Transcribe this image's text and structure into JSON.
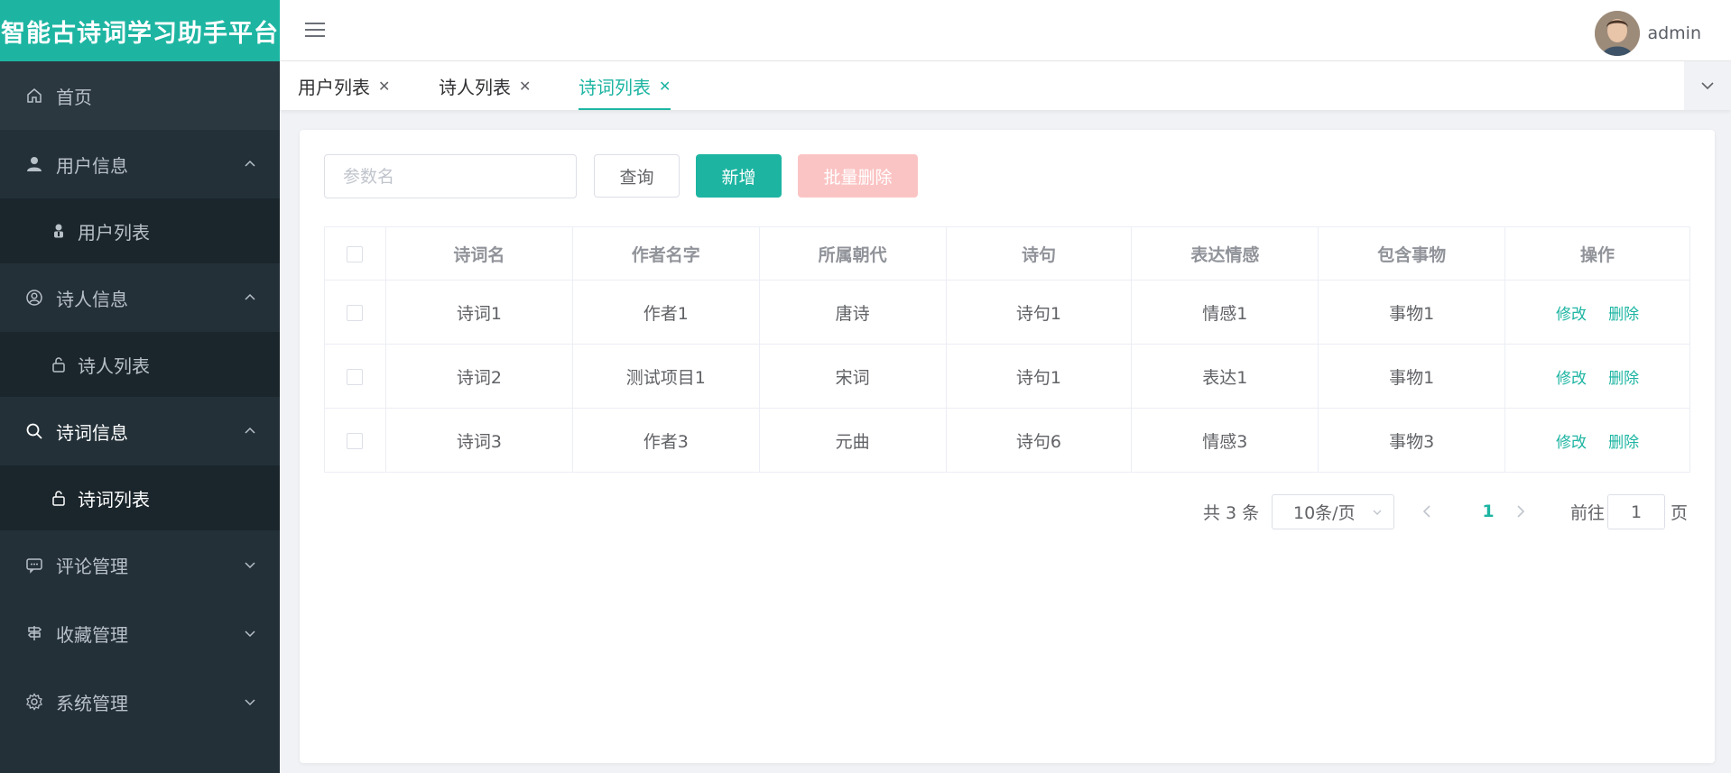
{
  "app": {
    "title": "智能古诗词学习助手平台"
  },
  "header": {
    "username": "admin"
  },
  "sidebar": {
    "home": "首页",
    "user_group": "用户信息",
    "user_list": "用户列表",
    "poet_group": "诗人信息",
    "poet_list": "诗人列表",
    "poem_group": "诗词信息",
    "poem_list": "诗词列表",
    "comment_group": "评论管理",
    "fav_group": "收藏管理",
    "system_group": "系统管理"
  },
  "tabs": [
    {
      "label": "用户列表",
      "active": false
    },
    {
      "label": "诗人列表",
      "active": false
    },
    {
      "label": "诗词列表",
      "active": true
    }
  ],
  "toolbar": {
    "search_placeholder": "参数名",
    "query_label": "查询",
    "add_label": "新增",
    "batch_delete_label": "批量删除"
  },
  "table": {
    "columns": [
      "诗词名",
      "作者名字",
      "所属朝代",
      "诗句",
      "表达情感",
      "包含事物",
      "操作"
    ],
    "rows": [
      {
        "name": "诗词1",
        "author": "作者1",
        "dynasty": "唐诗",
        "verse": "诗句1",
        "emotion": "情感1",
        "things": "事物1"
      },
      {
        "name": "诗词2",
        "author": "测试项目1",
        "dynasty": "宋词",
        "verse": "诗句1",
        "emotion": "表达1",
        "things": "事物1"
      },
      {
        "name": "诗词3",
        "author": "作者3",
        "dynasty": "元曲",
        "verse": "诗句6",
        "emotion": "情感3",
        "things": "事物3"
      }
    ],
    "edit_label": "修改",
    "delete_label": "删除"
  },
  "pagination": {
    "total_text": "共 3 条",
    "page_size": "10条/页",
    "current_page": "1",
    "goto_label": "前往",
    "goto_value": "1",
    "goto_suffix": "页"
  },
  "colors": {
    "accent": "#1db5a2",
    "sidebar_bg": "#233038",
    "danger_disabled": "#fbc4c4"
  }
}
